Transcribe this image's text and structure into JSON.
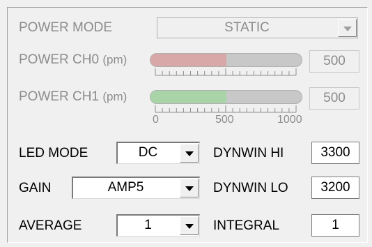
{
  "power_mode": {
    "label": "POWER MODE",
    "value": "STATIC"
  },
  "power_ch0": {
    "label": "POWER CH0",
    "unit": "(pm)",
    "value": "500",
    "level_fraction": 0.5,
    "color": "#d8a8a8"
  },
  "power_ch1": {
    "label": "POWER CH1",
    "unit": "(pm)",
    "value": "500",
    "level_fraction": 0.5,
    "color": "#a8d4a8"
  },
  "scale": {
    "min": "0",
    "mid": "500",
    "max": "1000"
  },
  "led_mode": {
    "label": "LED MODE",
    "value": "DC"
  },
  "gain": {
    "label": "GAIN",
    "value": "AMP5"
  },
  "average": {
    "label": "AVERAGE",
    "value": "1"
  },
  "dynwin_hi": {
    "label": "DYNWIN HI",
    "value": "3300"
  },
  "dynwin_lo": {
    "label": "DYNWIN LO",
    "value": "3200"
  },
  "integral": {
    "label": "INTEGRAL",
    "value": "1"
  }
}
